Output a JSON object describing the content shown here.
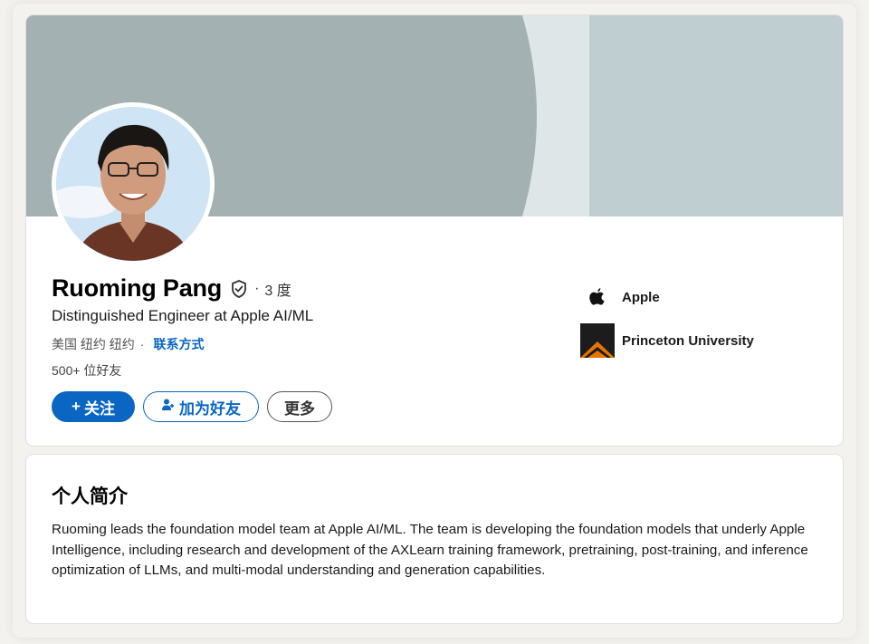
{
  "profile": {
    "name": "Ruoming Pang",
    "degree": "3 度",
    "headline": "Distinguished Engineer at Apple AI/ML",
    "location": "美国 纽约 纽约",
    "contact_label": "联系方式",
    "connections": "500+ 位好友",
    "buttons": {
      "follow_label": "关注",
      "add_friend_label": "加为好友",
      "more_label": "更多"
    },
    "icons": {
      "verified": "verified-shield-icon",
      "follow": "plus-icon",
      "add_friend": "person-add-icon"
    },
    "accent_color": "#0a66c2"
  },
  "sidebar": {
    "items": [
      {
        "label": "Apple",
        "icon": "apple-logo"
      },
      {
        "label": "Princeton University",
        "icon": "princeton-shield-logo"
      }
    ]
  },
  "about": {
    "title": "个人简介",
    "text": "Ruoming leads the foundation model team at Apple AI/ML. The team is developing the foundation models that underly Apple Intelligence, including research and development of the AXLearn training framework, pretraining, post-training, and inference optimization of LLMs, and multi-modal understanding and generation capabilities."
  }
}
